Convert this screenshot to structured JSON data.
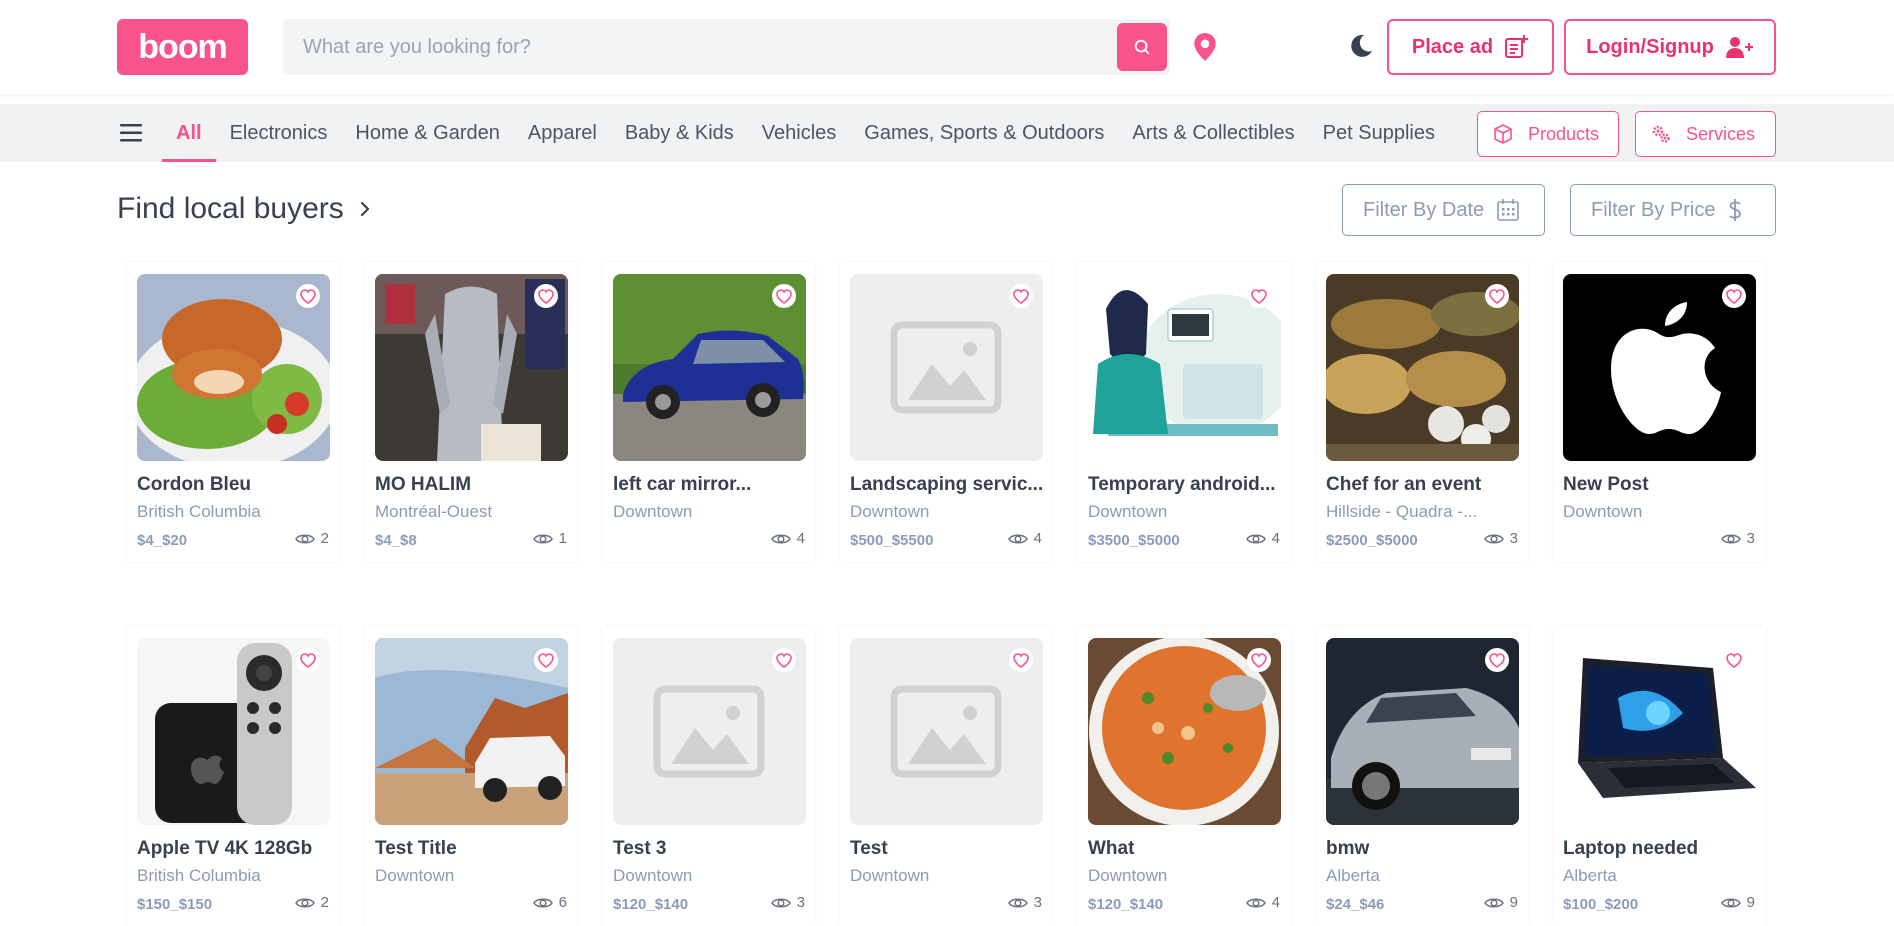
{
  "header": {
    "logo": "boom",
    "search_placeholder": "What are you looking for?",
    "place_ad": "Place ad",
    "login": "Login/Signup"
  },
  "categories": [
    "All",
    "Electronics",
    "Home & Garden",
    "Apparel",
    "Baby & Kids",
    "Vehicles",
    "Games, Sports & Outdoors",
    "Arts & Collectibles",
    "Pet Supplies"
  ],
  "toggles": {
    "products": "Products",
    "services": "Services"
  },
  "section": {
    "title": "Find local buyers",
    "filter_date": "Filter By Date",
    "filter_price": "Filter By Price"
  },
  "colors": {
    "accent": "#f8538d",
    "muted": "#8b9bb8"
  },
  "listings": [
    {
      "title": "Cordon Bleu",
      "location": "British Columbia",
      "price": "$4_$20",
      "views": "2",
      "image": "food-plate"
    },
    {
      "title": "MO HALIM",
      "location": "Montréal-Ouest",
      "price": "$4_$8",
      "views": "1",
      "image": "clothing"
    },
    {
      "title": "left car mirror...",
      "location": "Downtown",
      "price": "",
      "views": "4",
      "image": "blue-car"
    },
    {
      "title": "Landscaping servic...",
      "location": "Downtown",
      "price": "$500_$5500",
      "views": "4",
      "image": "placeholder"
    },
    {
      "title": "Temporary android...",
      "location": "Downtown",
      "price": "$3500_$5000",
      "views": "4",
      "image": "developer"
    },
    {
      "title": "Chef for an event",
      "location": "Hillside - Quadra -...",
      "price": "$2500_$5000",
      "views": "3",
      "image": "buffet"
    },
    {
      "title": "New Post",
      "location": "Downtown",
      "price": "",
      "views": "3",
      "image": "apple-logo"
    },
    {
      "title": "Apple TV 4K 128Gb",
      "location": "British Columbia",
      "price": "$150_$150",
      "views": "2",
      "image": "apple-tv"
    },
    {
      "title": "Test Title",
      "location": "Downtown",
      "price": "",
      "views": "6",
      "image": "suv-desert"
    },
    {
      "title": "Test 3",
      "location": "Downtown",
      "price": "$120_$140",
      "views": "3",
      "image": "placeholder"
    },
    {
      "title": "Test",
      "location": "Downtown",
      "price": "",
      "views": "3",
      "image": "placeholder"
    },
    {
      "title": "What",
      "location": "Downtown",
      "price": "$120_$140",
      "views": "4",
      "image": "soup"
    },
    {
      "title": "bmw",
      "location": "Alberta",
      "price": "$24_$46",
      "views": "9",
      "image": "silver-car"
    },
    {
      "title": "Laptop needed",
      "location": "Alberta",
      "price": "$100_$200",
      "views": "9",
      "image": "laptop"
    }
  ]
}
